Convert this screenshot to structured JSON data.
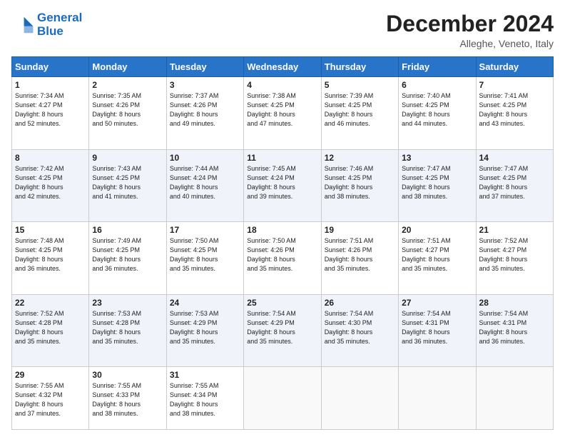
{
  "header": {
    "logo_line1": "General",
    "logo_line2": "Blue",
    "month": "December 2024",
    "location": "Alleghe, Veneto, Italy"
  },
  "days_of_week": [
    "Sunday",
    "Monday",
    "Tuesday",
    "Wednesday",
    "Thursday",
    "Friday",
    "Saturday"
  ],
  "weeks": [
    [
      {
        "day": 1,
        "lines": [
          "Sunrise: 7:34 AM",
          "Sunset: 4:27 PM",
          "Daylight: 8 hours",
          "and 52 minutes."
        ]
      },
      {
        "day": 2,
        "lines": [
          "Sunrise: 7:35 AM",
          "Sunset: 4:26 PM",
          "Daylight: 8 hours",
          "and 50 minutes."
        ]
      },
      {
        "day": 3,
        "lines": [
          "Sunrise: 7:37 AM",
          "Sunset: 4:26 PM",
          "Daylight: 8 hours",
          "and 49 minutes."
        ]
      },
      {
        "day": 4,
        "lines": [
          "Sunrise: 7:38 AM",
          "Sunset: 4:25 PM",
          "Daylight: 8 hours",
          "and 47 minutes."
        ]
      },
      {
        "day": 5,
        "lines": [
          "Sunrise: 7:39 AM",
          "Sunset: 4:25 PM",
          "Daylight: 8 hours",
          "and 46 minutes."
        ]
      },
      {
        "day": 6,
        "lines": [
          "Sunrise: 7:40 AM",
          "Sunset: 4:25 PM",
          "Daylight: 8 hours",
          "and 44 minutes."
        ]
      },
      {
        "day": 7,
        "lines": [
          "Sunrise: 7:41 AM",
          "Sunset: 4:25 PM",
          "Daylight: 8 hours",
          "and 43 minutes."
        ]
      }
    ],
    [
      {
        "day": 8,
        "lines": [
          "Sunrise: 7:42 AM",
          "Sunset: 4:25 PM",
          "Daylight: 8 hours",
          "and 42 minutes."
        ]
      },
      {
        "day": 9,
        "lines": [
          "Sunrise: 7:43 AM",
          "Sunset: 4:25 PM",
          "Daylight: 8 hours",
          "and 41 minutes."
        ]
      },
      {
        "day": 10,
        "lines": [
          "Sunrise: 7:44 AM",
          "Sunset: 4:24 PM",
          "Daylight: 8 hours",
          "and 40 minutes."
        ]
      },
      {
        "day": 11,
        "lines": [
          "Sunrise: 7:45 AM",
          "Sunset: 4:24 PM",
          "Daylight: 8 hours",
          "and 39 minutes."
        ]
      },
      {
        "day": 12,
        "lines": [
          "Sunrise: 7:46 AM",
          "Sunset: 4:25 PM",
          "Daylight: 8 hours",
          "and 38 minutes."
        ]
      },
      {
        "day": 13,
        "lines": [
          "Sunrise: 7:47 AM",
          "Sunset: 4:25 PM",
          "Daylight: 8 hours",
          "and 38 minutes."
        ]
      },
      {
        "day": 14,
        "lines": [
          "Sunrise: 7:47 AM",
          "Sunset: 4:25 PM",
          "Daylight: 8 hours",
          "and 37 minutes."
        ]
      }
    ],
    [
      {
        "day": 15,
        "lines": [
          "Sunrise: 7:48 AM",
          "Sunset: 4:25 PM",
          "Daylight: 8 hours",
          "and 36 minutes."
        ]
      },
      {
        "day": 16,
        "lines": [
          "Sunrise: 7:49 AM",
          "Sunset: 4:25 PM",
          "Daylight: 8 hours",
          "and 36 minutes."
        ]
      },
      {
        "day": 17,
        "lines": [
          "Sunrise: 7:50 AM",
          "Sunset: 4:25 PM",
          "Daylight: 8 hours",
          "and 35 minutes."
        ]
      },
      {
        "day": 18,
        "lines": [
          "Sunrise: 7:50 AM",
          "Sunset: 4:26 PM",
          "Daylight: 8 hours",
          "and 35 minutes."
        ]
      },
      {
        "day": 19,
        "lines": [
          "Sunrise: 7:51 AM",
          "Sunset: 4:26 PM",
          "Daylight: 8 hours",
          "and 35 minutes."
        ]
      },
      {
        "day": 20,
        "lines": [
          "Sunrise: 7:51 AM",
          "Sunset: 4:27 PM",
          "Daylight: 8 hours",
          "and 35 minutes."
        ]
      },
      {
        "day": 21,
        "lines": [
          "Sunrise: 7:52 AM",
          "Sunset: 4:27 PM",
          "Daylight: 8 hours",
          "and 35 minutes."
        ]
      }
    ],
    [
      {
        "day": 22,
        "lines": [
          "Sunrise: 7:52 AM",
          "Sunset: 4:28 PM",
          "Daylight: 8 hours",
          "and 35 minutes."
        ]
      },
      {
        "day": 23,
        "lines": [
          "Sunrise: 7:53 AM",
          "Sunset: 4:28 PM",
          "Daylight: 8 hours",
          "and 35 minutes."
        ]
      },
      {
        "day": 24,
        "lines": [
          "Sunrise: 7:53 AM",
          "Sunset: 4:29 PM",
          "Daylight: 8 hours",
          "and 35 minutes."
        ]
      },
      {
        "day": 25,
        "lines": [
          "Sunrise: 7:54 AM",
          "Sunset: 4:29 PM",
          "Daylight: 8 hours",
          "and 35 minutes."
        ]
      },
      {
        "day": 26,
        "lines": [
          "Sunrise: 7:54 AM",
          "Sunset: 4:30 PM",
          "Daylight: 8 hours",
          "and 35 minutes."
        ]
      },
      {
        "day": 27,
        "lines": [
          "Sunrise: 7:54 AM",
          "Sunset: 4:31 PM",
          "Daylight: 8 hours",
          "and 36 minutes."
        ]
      },
      {
        "day": 28,
        "lines": [
          "Sunrise: 7:54 AM",
          "Sunset: 4:31 PM",
          "Daylight: 8 hours",
          "and 36 minutes."
        ]
      }
    ],
    [
      {
        "day": 29,
        "lines": [
          "Sunrise: 7:55 AM",
          "Sunset: 4:32 PM",
          "Daylight: 8 hours",
          "and 37 minutes."
        ]
      },
      {
        "day": 30,
        "lines": [
          "Sunrise: 7:55 AM",
          "Sunset: 4:33 PM",
          "Daylight: 8 hours",
          "and 38 minutes."
        ]
      },
      {
        "day": 31,
        "lines": [
          "Sunrise: 7:55 AM",
          "Sunset: 4:34 PM",
          "Daylight: 8 hours",
          "and 38 minutes."
        ]
      },
      null,
      null,
      null,
      null
    ]
  ]
}
